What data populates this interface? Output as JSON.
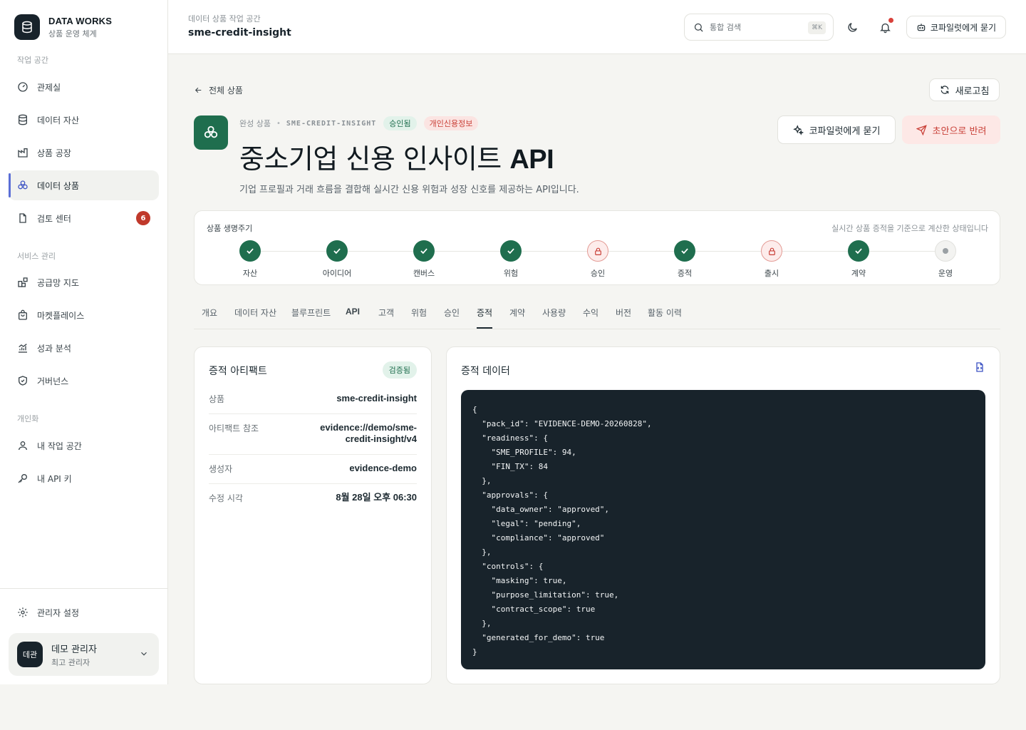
{
  "brand": {
    "title": "DATA WORKS",
    "subtitle": "상품 운영 체계"
  },
  "sidebar": {
    "sections": [
      "작업 공간",
      "서비스 관리",
      "개인화"
    ],
    "items": [
      {
        "label": "관제실",
        "icon": "gauge-icon"
      },
      {
        "label": "데이터 자산",
        "icon": "database-icon"
      },
      {
        "label": "상품 공장",
        "icon": "factory-icon"
      },
      {
        "label": "데이터 상품",
        "icon": "blocks-icon",
        "active": true
      },
      {
        "label": "검토 센터",
        "icon": "document-icon",
        "badge": "6"
      },
      {
        "label": "공급망 지도",
        "icon": "grid-icon"
      },
      {
        "label": "마켓플레이스",
        "icon": "shopping-bag-icon"
      },
      {
        "label": "성과 분석",
        "icon": "chart-icon"
      },
      {
        "label": "거버넌스",
        "icon": "shield-icon"
      },
      {
        "label": "내 작업 공간",
        "icon": "user-icon"
      },
      {
        "label": "내 API 키",
        "icon": "key-icon"
      }
    ],
    "admin_settings": "관리자 설정",
    "user": {
      "avatar": "데관",
      "name": "데모 관리자",
      "role": "최고 관리자"
    }
  },
  "header": {
    "breadcrumb": "데이터 상품 작업 공간",
    "title": "sme-credit-insight",
    "search_placeholder": "통합 검색",
    "search_shortcut": "⌘K",
    "copilot_label": "코파일럿에게 묻기"
  },
  "page": {
    "back_label": "전체 상품",
    "refresh_label": "새로고침",
    "copilot_label": "코파일럿에게 묻기",
    "reject_label": "초안으로 반려",
    "meta_label": "완성 상품",
    "meta_code": "SME-CREDIT-INSIGHT",
    "status_pill": "승인됨",
    "sensitivity_pill": "개인신용정보",
    "title_main": "중소기업 신용 인사이트",
    "title_strong": "API",
    "description": "기업 프로필과 거래 흐름을 결합해 실시간 신용 위험과 성장 신호를 제공하는 API입니다."
  },
  "lifecycle": {
    "title": "상품 생명주기",
    "note": "실시간 상품 증적을 기준으로 계산한 상태입니다",
    "steps": [
      {
        "label": "자산",
        "state": "done"
      },
      {
        "label": "아이디어",
        "state": "done"
      },
      {
        "label": "캔버스",
        "state": "done"
      },
      {
        "label": "위험",
        "state": "done"
      },
      {
        "label": "승인",
        "state": "locked"
      },
      {
        "label": "증적",
        "state": "done"
      },
      {
        "label": "출시",
        "state": "locked"
      },
      {
        "label": "계약",
        "state": "done"
      },
      {
        "label": "운영",
        "state": "pending"
      }
    ]
  },
  "tabs": [
    "개요",
    "데이터 자산",
    "블루프린트",
    "API",
    "고객",
    "위험",
    "승인",
    "증적",
    "계약",
    "사용량",
    "수익",
    "버전",
    "활동 이력"
  ],
  "active_tab": "증적",
  "artifact": {
    "title": "증적 아티팩트",
    "badge": "검증됨",
    "rows": [
      {
        "key": "상품",
        "value": "sme-credit-insight"
      },
      {
        "key": "아티팩트 참조",
        "value": "evidence://demo/sme-credit-insight/v4"
      },
      {
        "key": "생성자",
        "value": "evidence-demo"
      },
      {
        "key": "수정 시각",
        "value": "8월 28일 오후 06:30"
      }
    ]
  },
  "evidence": {
    "title": "증적 데이터",
    "json": "{\n  \"pack_id\": \"EVIDENCE-DEMO-20260828\",\n  \"readiness\": {\n    \"SME_PROFILE\": 94,\n    \"FIN_TX\": 84\n  },\n  \"approvals\": {\n    \"data_owner\": \"approved\",\n    \"legal\": \"pending\",\n    \"compliance\": \"approved\"\n  },\n  \"controls\": {\n    \"masking\": true,\n    \"purpose_limitation\": true,\n    \"contract_scope\": true\n  },\n  \"generated_for_demo\": true\n}"
  },
  "colors": {
    "accent_green": "#1f6e4e",
    "danger_red": "#c94038",
    "nav_active_bar": "#5b6fd6",
    "code_bg": "#18232b"
  }
}
